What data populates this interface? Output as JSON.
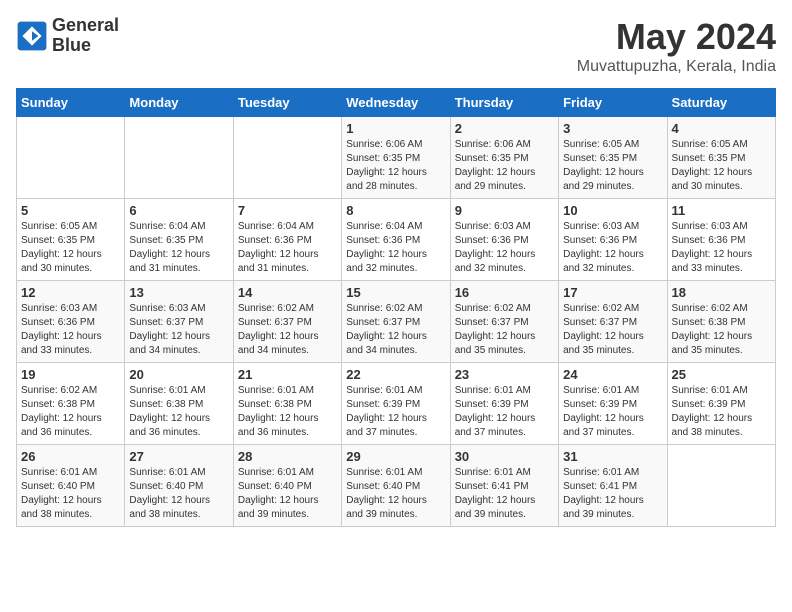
{
  "logo": {
    "line1": "General",
    "line2": "Blue"
  },
  "title": "May 2024",
  "subtitle": "Muvattupuzha, Kerala, India",
  "days_header": [
    "Sunday",
    "Monday",
    "Tuesday",
    "Wednesday",
    "Thursday",
    "Friday",
    "Saturday"
  ],
  "weeks": [
    [
      {
        "day": "",
        "info": ""
      },
      {
        "day": "",
        "info": ""
      },
      {
        "day": "",
        "info": ""
      },
      {
        "day": "1",
        "info": "Sunrise: 6:06 AM\nSunset: 6:35 PM\nDaylight: 12 hours\nand 28 minutes."
      },
      {
        "day": "2",
        "info": "Sunrise: 6:06 AM\nSunset: 6:35 PM\nDaylight: 12 hours\nand 29 minutes."
      },
      {
        "day": "3",
        "info": "Sunrise: 6:05 AM\nSunset: 6:35 PM\nDaylight: 12 hours\nand 29 minutes."
      },
      {
        "day": "4",
        "info": "Sunrise: 6:05 AM\nSunset: 6:35 PM\nDaylight: 12 hours\nand 30 minutes."
      }
    ],
    [
      {
        "day": "5",
        "info": "Sunrise: 6:05 AM\nSunset: 6:35 PM\nDaylight: 12 hours\nand 30 minutes."
      },
      {
        "day": "6",
        "info": "Sunrise: 6:04 AM\nSunset: 6:35 PM\nDaylight: 12 hours\nand 31 minutes."
      },
      {
        "day": "7",
        "info": "Sunrise: 6:04 AM\nSunset: 6:36 PM\nDaylight: 12 hours\nand 31 minutes."
      },
      {
        "day": "8",
        "info": "Sunrise: 6:04 AM\nSunset: 6:36 PM\nDaylight: 12 hours\nand 32 minutes."
      },
      {
        "day": "9",
        "info": "Sunrise: 6:03 AM\nSunset: 6:36 PM\nDaylight: 12 hours\nand 32 minutes."
      },
      {
        "day": "10",
        "info": "Sunrise: 6:03 AM\nSunset: 6:36 PM\nDaylight: 12 hours\nand 32 minutes."
      },
      {
        "day": "11",
        "info": "Sunrise: 6:03 AM\nSunset: 6:36 PM\nDaylight: 12 hours\nand 33 minutes."
      }
    ],
    [
      {
        "day": "12",
        "info": "Sunrise: 6:03 AM\nSunset: 6:36 PM\nDaylight: 12 hours\nand 33 minutes."
      },
      {
        "day": "13",
        "info": "Sunrise: 6:03 AM\nSunset: 6:37 PM\nDaylight: 12 hours\nand 34 minutes."
      },
      {
        "day": "14",
        "info": "Sunrise: 6:02 AM\nSunset: 6:37 PM\nDaylight: 12 hours\nand 34 minutes."
      },
      {
        "day": "15",
        "info": "Sunrise: 6:02 AM\nSunset: 6:37 PM\nDaylight: 12 hours\nand 34 minutes."
      },
      {
        "day": "16",
        "info": "Sunrise: 6:02 AM\nSunset: 6:37 PM\nDaylight: 12 hours\nand 35 minutes."
      },
      {
        "day": "17",
        "info": "Sunrise: 6:02 AM\nSunset: 6:37 PM\nDaylight: 12 hours\nand 35 minutes."
      },
      {
        "day": "18",
        "info": "Sunrise: 6:02 AM\nSunset: 6:38 PM\nDaylight: 12 hours\nand 35 minutes."
      }
    ],
    [
      {
        "day": "19",
        "info": "Sunrise: 6:02 AM\nSunset: 6:38 PM\nDaylight: 12 hours\nand 36 minutes."
      },
      {
        "day": "20",
        "info": "Sunrise: 6:01 AM\nSunset: 6:38 PM\nDaylight: 12 hours\nand 36 minutes."
      },
      {
        "day": "21",
        "info": "Sunrise: 6:01 AM\nSunset: 6:38 PM\nDaylight: 12 hours\nand 36 minutes."
      },
      {
        "day": "22",
        "info": "Sunrise: 6:01 AM\nSunset: 6:39 PM\nDaylight: 12 hours\nand 37 minutes."
      },
      {
        "day": "23",
        "info": "Sunrise: 6:01 AM\nSunset: 6:39 PM\nDaylight: 12 hours\nand 37 minutes."
      },
      {
        "day": "24",
        "info": "Sunrise: 6:01 AM\nSunset: 6:39 PM\nDaylight: 12 hours\nand 37 minutes."
      },
      {
        "day": "25",
        "info": "Sunrise: 6:01 AM\nSunset: 6:39 PM\nDaylight: 12 hours\nand 38 minutes."
      }
    ],
    [
      {
        "day": "26",
        "info": "Sunrise: 6:01 AM\nSunset: 6:40 PM\nDaylight: 12 hours\nand 38 minutes."
      },
      {
        "day": "27",
        "info": "Sunrise: 6:01 AM\nSunset: 6:40 PM\nDaylight: 12 hours\nand 38 minutes."
      },
      {
        "day": "28",
        "info": "Sunrise: 6:01 AM\nSunset: 6:40 PM\nDaylight: 12 hours\nand 39 minutes."
      },
      {
        "day": "29",
        "info": "Sunrise: 6:01 AM\nSunset: 6:40 PM\nDaylight: 12 hours\nand 39 minutes."
      },
      {
        "day": "30",
        "info": "Sunrise: 6:01 AM\nSunset: 6:41 PM\nDaylight: 12 hours\nand 39 minutes."
      },
      {
        "day": "31",
        "info": "Sunrise: 6:01 AM\nSunset: 6:41 PM\nDaylight: 12 hours\nand 39 minutes."
      },
      {
        "day": "",
        "info": ""
      }
    ]
  ]
}
